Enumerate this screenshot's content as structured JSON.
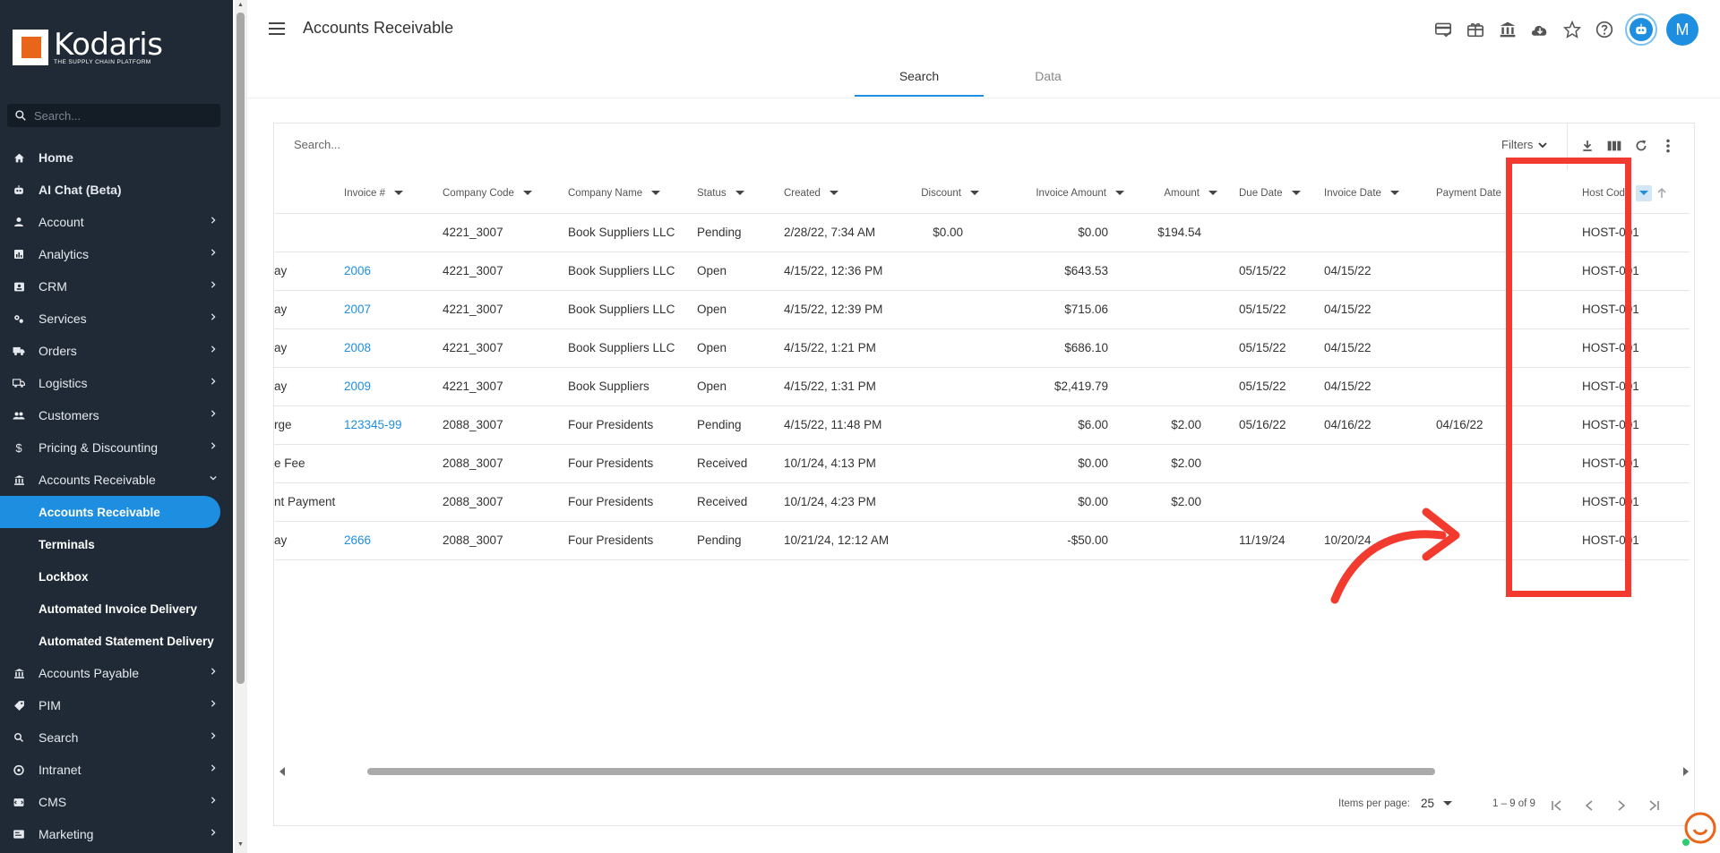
{
  "brand": {
    "name": "Kodaris",
    "tagline": "THE SUPPLY CHAIN PLATFORM"
  },
  "sidebar": {
    "search_placeholder": "Search...",
    "items": [
      {
        "label": "Home",
        "icon": "home-icon",
        "bold": true
      },
      {
        "label": "AI Chat (Beta)",
        "icon": "robot-icon",
        "bold": true
      },
      {
        "label": "Account",
        "icon": "person-icon"
      },
      {
        "label": "Analytics",
        "icon": "chart-icon"
      },
      {
        "label": "CRM",
        "icon": "contacts-icon"
      },
      {
        "label": "Services",
        "icon": "services-icon"
      },
      {
        "label": "Orders",
        "icon": "truck-icon"
      },
      {
        "label": "Logistics",
        "icon": "shipping-icon"
      },
      {
        "label": "Customers",
        "icon": "people-icon"
      },
      {
        "label": "Pricing & Discounting",
        "icon": "dollar-icon"
      },
      {
        "label": "Accounts Receivable",
        "icon": "bank-icon",
        "expanded": true
      }
    ],
    "subitems": [
      {
        "label": "Accounts Receivable",
        "active": true
      },
      {
        "label": "Terminals"
      },
      {
        "label": "Lockbox"
      },
      {
        "label": "Automated Invoice Delivery"
      },
      {
        "label": "Automated Statement Delivery"
      }
    ],
    "items_after": [
      {
        "label": "Accounts Payable",
        "icon": "bank-icon"
      },
      {
        "label": "PIM",
        "icon": "tag-icon"
      },
      {
        "label": "Search",
        "icon": "search-icon"
      },
      {
        "label": "Intranet",
        "icon": "intranet-icon"
      },
      {
        "label": "CMS",
        "icon": "cms-icon"
      },
      {
        "label": "Marketing",
        "icon": "marketing-icon"
      }
    ]
  },
  "header": {
    "title": "Accounts Receivable",
    "avatar_initial": "M",
    "tabs": [
      {
        "label": "Search",
        "active": true
      },
      {
        "label": "Data",
        "active": false
      }
    ]
  },
  "table": {
    "search_placeholder": "Search...",
    "filters_label": "Filters",
    "columns": [
      "Invoice #",
      "Company Code",
      "Company Name",
      "Status",
      "Created",
      "Discount",
      "Invoice Amount",
      "Amount",
      "Due Date",
      "Invoice Date",
      "Payment Date",
      "Host Code"
    ],
    "rows": [
      {
        "type": "",
        "invoice": "",
        "company_code": "4221_3007",
        "company_name": "Book Suppliers LLC",
        "status": "Pending",
        "created": "2/28/22, 7:34 AM",
        "discount": "$0.00",
        "invoice_amount": "$0.00",
        "amount": "$194.54",
        "due_date": "",
        "invoice_date": "",
        "payment_date": "",
        "host_code": "HOST-001"
      },
      {
        "type": "ay",
        "invoice": "2006",
        "company_code": "4221_3007",
        "company_name": "Book Suppliers LLC",
        "status": "Open",
        "created": "4/15/22, 12:36 PM",
        "discount": "",
        "invoice_amount": "$643.53",
        "amount": "",
        "due_date": "05/15/22",
        "invoice_date": "04/15/22",
        "payment_date": "",
        "host_code": "HOST-001"
      },
      {
        "type": "ay",
        "invoice": "2007",
        "company_code": "4221_3007",
        "company_name": "Book Suppliers LLC",
        "status": "Open",
        "created": "4/15/22, 12:39 PM",
        "discount": "",
        "invoice_amount": "$715.06",
        "amount": "",
        "due_date": "05/15/22",
        "invoice_date": "04/15/22",
        "payment_date": "",
        "host_code": "HOST-001"
      },
      {
        "type": "ay",
        "invoice": "2008",
        "company_code": "4221_3007",
        "company_name": "Book Suppliers LLC",
        "status": "Open",
        "created": "4/15/22, 1:21 PM",
        "discount": "",
        "invoice_amount": "$686.10",
        "amount": "",
        "due_date": "05/15/22",
        "invoice_date": "04/15/22",
        "payment_date": "",
        "host_code": "HOST-001"
      },
      {
        "type": "ay",
        "invoice": "2009",
        "company_code": "4221_3007",
        "company_name": "Book Suppliers",
        "status": "Open",
        "created": "4/15/22, 1:31 PM",
        "discount": "",
        "invoice_amount": "$2,419.79",
        "amount": "",
        "due_date": "05/15/22",
        "invoice_date": "04/15/22",
        "payment_date": "",
        "host_code": "HOST-001"
      },
      {
        "type": "rge",
        "invoice": "123345-99",
        "company_code": "2088_3007",
        "company_name": "Four Presidents",
        "status": "Pending",
        "created": "4/15/22, 11:48 PM",
        "discount": "",
        "invoice_amount": "$6.00",
        "amount": "$2.00",
        "due_date": "05/16/22",
        "invoice_date": "04/16/22",
        "payment_date": "04/16/22",
        "host_code": "HOST-001"
      },
      {
        "type": "e Fee",
        "invoice": "",
        "company_code": "2088_3007",
        "company_name": "Four Presidents",
        "status": "Received",
        "created": "10/1/24, 4:13 PM",
        "discount": "",
        "invoice_amount": "$0.00",
        "amount": "$2.00",
        "due_date": "",
        "invoice_date": "",
        "payment_date": "",
        "host_code": "HOST-001"
      },
      {
        "type": "nt Payment",
        "invoice": "",
        "company_code": "2088_3007",
        "company_name": "Four Presidents",
        "status": "Received",
        "created": "10/1/24, 4:23 PM",
        "discount": "",
        "invoice_amount": "$0.00",
        "amount": "$2.00",
        "due_date": "",
        "invoice_date": "",
        "payment_date": "",
        "host_code": "HOST-001"
      },
      {
        "type": "ay",
        "invoice": "2666",
        "company_code": "2088_3007",
        "company_name": "Four Presidents",
        "status": "Pending",
        "created": "10/21/24, 12:12 AM",
        "discount": "",
        "invoice_amount": "-$50.00",
        "amount": "",
        "due_date": "11/19/24",
        "invoice_date": "10/20/24",
        "payment_date": "",
        "host_code": "HOST-001"
      }
    ]
  },
  "paginator": {
    "items_per_page_label": "Items per page:",
    "items_per_page": "25",
    "range": "1 – 9 of 9"
  },
  "colors": {
    "accent": "#1e8fe0",
    "sidebar_bg": "#1f2a36",
    "highlight": "#f23a2f"
  }
}
